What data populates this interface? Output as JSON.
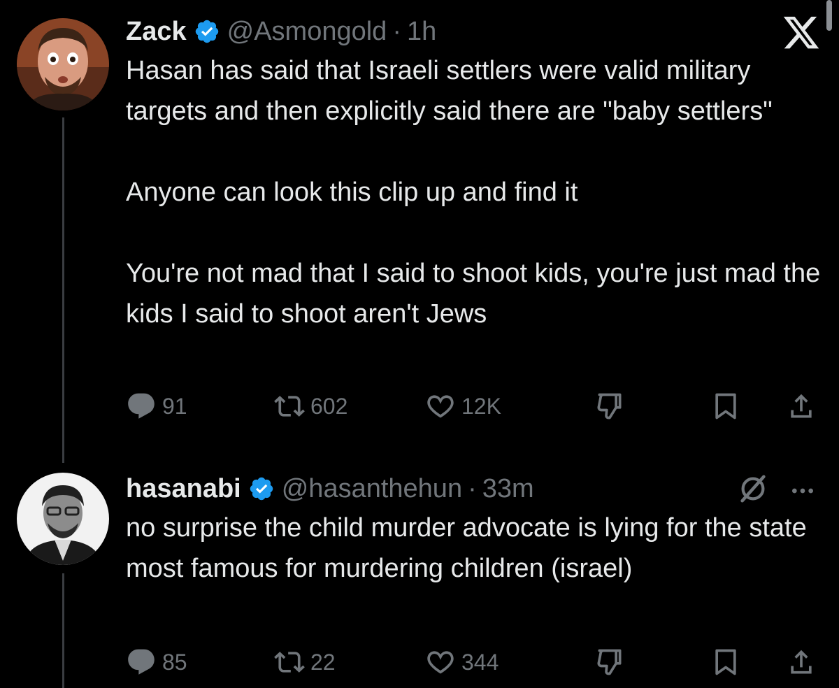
{
  "tweets": [
    {
      "name": "Zack",
      "handle": "@Asmongold",
      "separator": "·",
      "time": "1h",
      "paragraphs": [
        "Hasan has said that Israeli settlers were valid military targets and then explicitly said there are \"baby settlers\"",
        "Anyone can look this clip up and find it",
        "You're not mad that I said to shoot kids, you're just mad the kids I said to shoot aren't Jews"
      ],
      "stats": {
        "replies": "91",
        "retweets": "602",
        "likes": "12K"
      },
      "avatar_icon": "avatar-zack",
      "top_right_icon": "x-logo-icon"
    },
    {
      "name": "hasanabi",
      "handle": "@hasanthehun",
      "separator": "·",
      "time": "33m",
      "paragraphs": [
        "no surprise the child murder advocate is lying for the state most famous for murdering children (israel)"
      ],
      "stats": {
        "replies": "85",
        "retweets": "22",
        "likes": "344"
      },
      "avatar_icon": "avatar-hasanabi",
      "top_right_icons": [
        "grok-icon",
        "more-icon"
      ]
    }
  ],
  "icons": {
    "reply": "reply-icon",
    "retweet": "retweet-icon",
    "like": "heart-icon",
    "dislike": "thumbs-down-icon",
    "bookmark": "bookmark-icon",
    "share": "share-icon",
    "verified": "verified-badge-icon"
  },
  "colors": {
    "background": "#000000",
    "text": "#e7e9ea",
    "muted": "#71767b",
    "verified": "#1d9bf0",
    "thread_line": "#3a3d41"
  }
}
